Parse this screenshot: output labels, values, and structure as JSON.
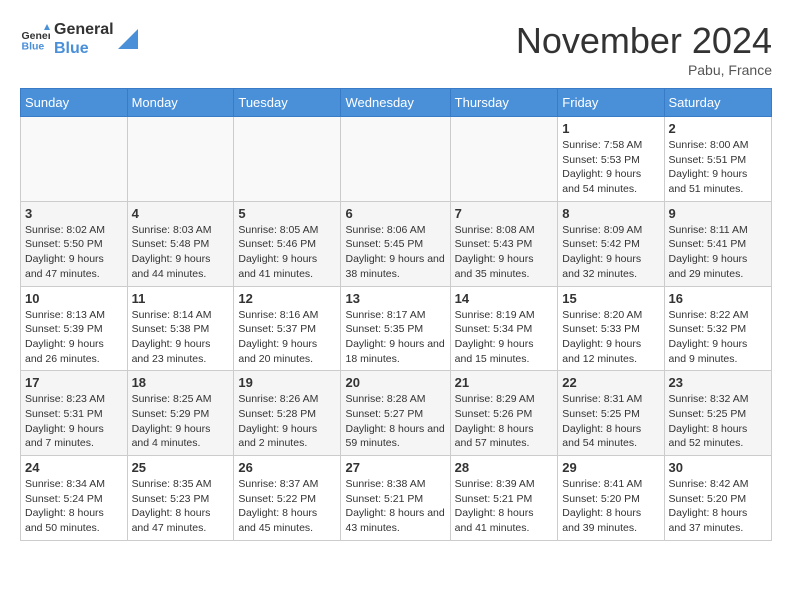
{
  "logo": {
    "line1": "General",
    "line2": "Blue"
  },
  "title": "November 2024",
  "location": "Pabu, France",
  "days_of_week": [
    "Sunday",
    "Monday",
    "Tuesday",
    "Wednesday",
    "Thursday",
    "Friday",
    "Saturday"
  ],
  "weeks": [
    [
      {
        "day": "",
        "info": ""
      },
      {
        "day": "",
        "info": ""
      },
      {
        "day": "",
        "info": ""
      },
      {
        "day": "",
        "info": ""
      },
      {
        "day": "",
        "info": ""
      },
      {
        "day": "1",
        "info": "Sunrise: 7:58 AM\nSunset: 5:53 PM\nDaylight: 9 hours and 54 minutes."
      },
      {
        "day": "2",
        "info": "Sunrise: 8:00 AM\nSunset: 5:51 PM\nDaylight: 9 hours and 51 minutes."
      }
    ],
    [
      {
        "day": "3",
        "info": "Sunrise: 8:02 AM\nSunset: 5:50 PM\nDaylight: 9 hours and 47 minutes."
      },
      {
        "day": "4",
        "info": "Sunrise: 8:03 AM\nSunset: 5:48 PM\nDaylight: 9 hours and 44 minutes."
      },
      {
        "day": "5",
        "info": "Sunrise: 8:05 AM\nSunset: 5:46 PM\nDaylight: 9 hours and 41 minutes."
      },
      {
        "day": "6",
        "info": "Sunrise: 8:06 AM\nSunset: 5:45 PM\nDaylight: 9 hours and 38 minutes."
      },
      {
        "day": "7",
        "info": "Sunrise: 8:08 AM\nSunset: 5:43 PM\nDaylight: 9 hours and 35 minutes."
      },
      {
        "day": "8",
        "info": "Sunrise: 8:09 AM\nSunset: 5:42 PM\nDaylight: 9 hours and 32 minutes."
      },
      {
        "day": "9",
        "info": "Sunrise: 8:11 AM\nSunset: 5:41 PM\nDaylight: 9 hours and 29 minutes."
      }
    ],
    [
      {
        "day": "10",
        "info": "Sunrise: 8:13 AM\nSunset: 5:39 PM\nDaylight: 9 hours and 26 minutes."
      },
      {
        "day": "11",
        "info": "Sunrise: 8:14 AM\nSunset: 5:38 PM\nDaylight: 9 hours and 23 minutes."
      },
      {
        "day": "12",
        "info": "Sunrise: 8:16 AM\nSunset: 5:37 PM\nDaylight: 9 hours and 20 minutes."
      },
      {
        "day": "13",
        "info": "Sunrise: 8:17 AM\nSunset: 5:35 PM\nDaylight: 9 hours and 18 minutes."
      },
      {
        "day": "14",
        "info": "Sunrise: 8:19 AM\nSunset: 5:34 PM\nDaylight: 9 hours and 15 minutes."
      },
      {
        "day": "15",
        "info": "Sunrise: 8:20 AM\nSunset: 5:33 PM\nDaylight: 9 hours and 12 minutes."
      },
      {
        "day": "16",
        "info": "Sunrise: 8:22 AM\nSunset: 5:32 PM\nDaylight: 9 hours and 9 minutes."
      }
    ],
    [
      {
        "day": "17",
        "info": "Sunrise: 8:23 AM\nSunset: 5:31 PM\nDaylight: 9 hours and 7 minutes."
      },
      {
        "day": "18",
        "info": "Sunrise: 8:25 AM\nSunset: 5:29 PM\nDaylight: 9 hours and 4 minutes."
      },
      {
        "day": "19",
        "info": "Sunrise: 8:26 AM\nSunset: 5:28 PM\nDaylight: 9 hours and 2 minutes."
      },
      {
        "day": "20",
        "info": "Sunrise: 8:28 AM\nSunset: 5:27 PM\nDaylight: 8 hours and 59 minutes."
      },
      {
        "day": "21",
        "info": "Sunrise: 8:29 AM\nSunset: 5:26 PM\nDaylight: 8 hours and 57 minutes."
      },
      {
        "day": "22",
        "info": "Sunrise: 8:31 AM\nSunset: 5:25 PM\nDaylight: 8 hours and 54 minutes."
      },
      {
        "day": "23",
        "info": "Sunrise: 8:32 AM\nSunset: 5:25 PM\nDaylight: 8 hours and 52 minutes."
      }
    ],
    [
      {
        "day": "24",
        "info": "Sunrise: 8:34 AM\nSunset: 5:24 PM\nDaylight: 8 hours and 50 minutes."
      },
      {
        "day": "25",
        "info": "Sunrise: 8:35 AM\nSunset: 5:23 PM\nDaylight: 8 hours and 47 minutes."
      },
      {
        "day": "26",
        "info": "Sunrise: 8:37 AM\nSunset: 5:22 PM\nDaylight: 8 hours and 45 minutes."
      },
      {
        "day": "27",
        "info": "Sunrise: 8:38 AM\nSunset: 5:21 PM\nDaylight: 8 hours and 43 minutes."
      },
      {
        "day": "28",
        "info": "Sunrise: 8:39 AM\nSunset: 5:21 PM\nDaylight: 8 hours and 41 minutes."
      },
      {
        "day": "29",
        "info": "Sunrise: 8:41 AM\nSunset: 5:20 PM\nDaylight: 8 hours and 39 minutes."
      },
      {
        "day": "30",
        "info": "Sunrise: 8:42 AM\nSunset: 5:20 PM\nDaylight: 8 hours and 37 minutes."
      }
    ]
  ]
}
